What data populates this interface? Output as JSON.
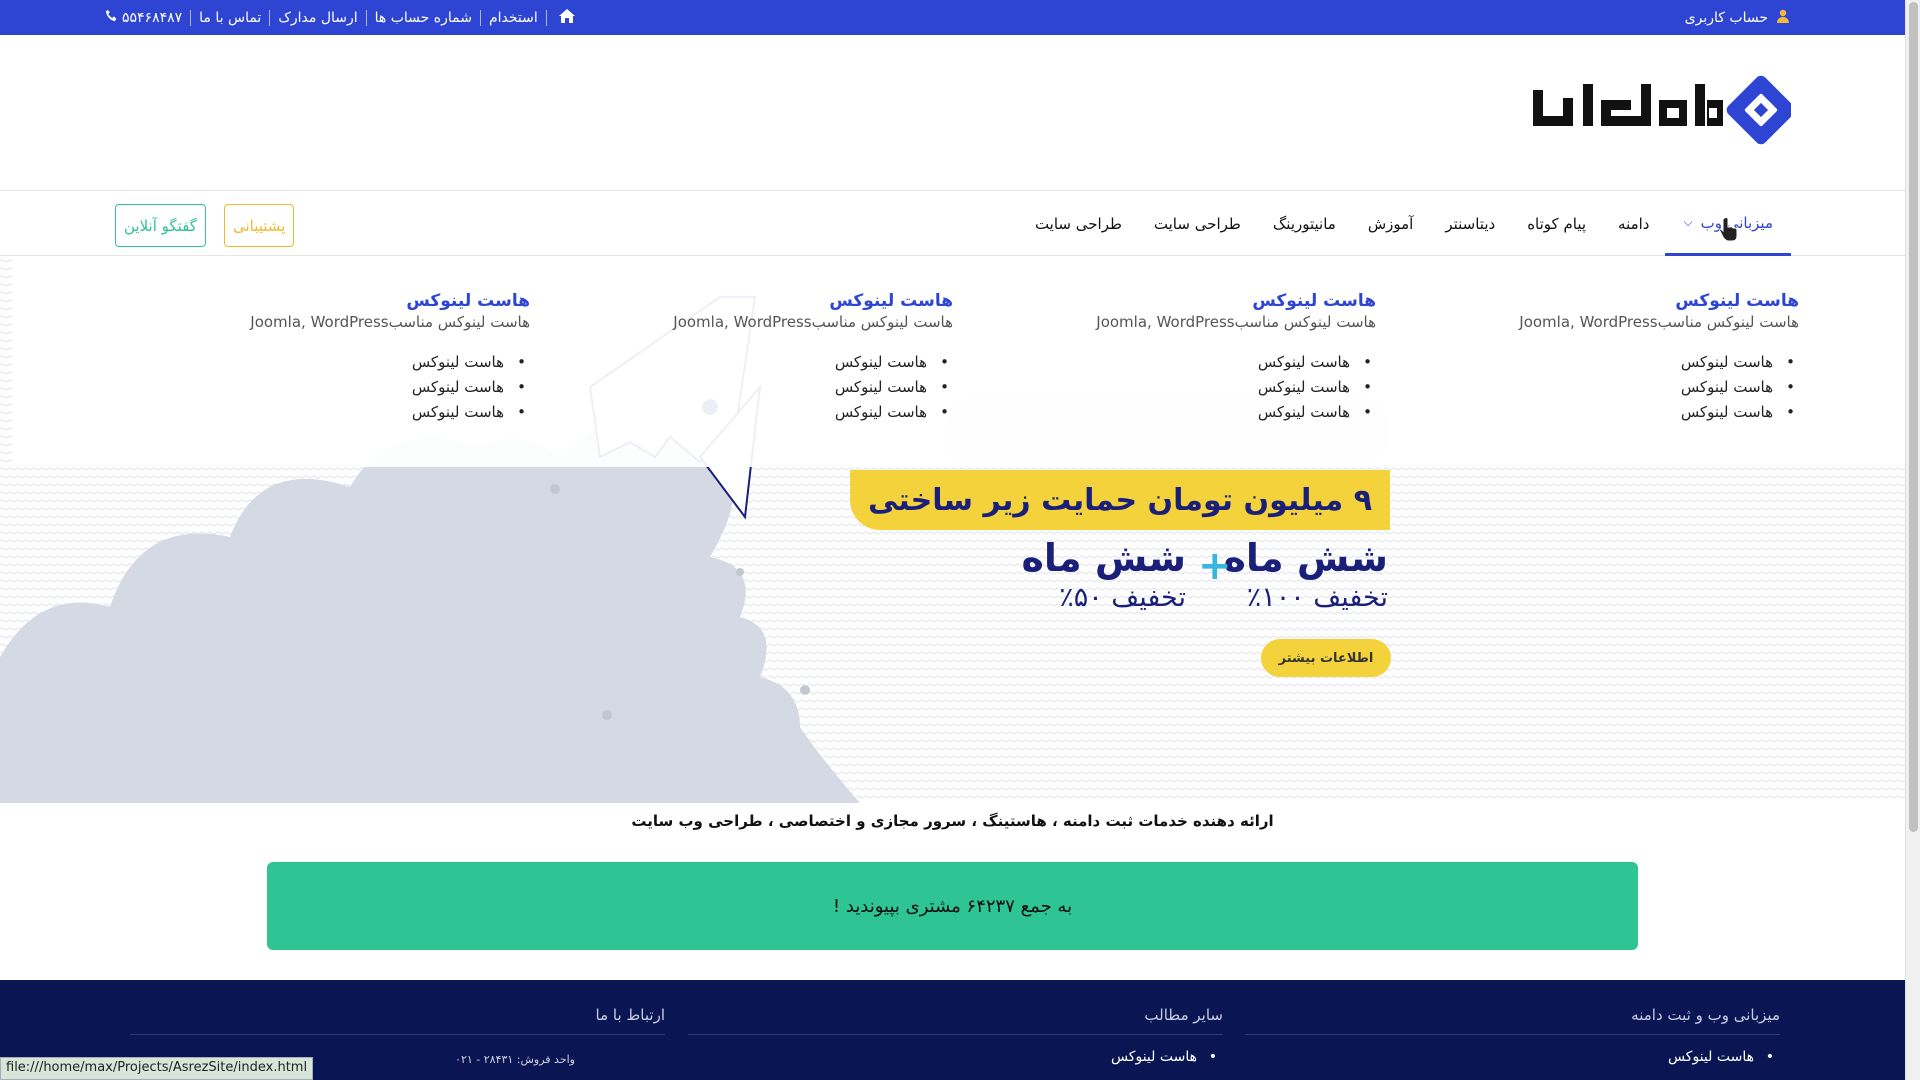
{
  "topbar": {
    "account": "حساب کاربری",
    "links": [
      "استخدام",
      "شماره حساب ها",
      "ارسال مدارک",
      "تماس با ما"
    ],
    "phone": "۵۵۴۶۸۴۸۷"
  },
  "logo": {
    "text": "هاست ایران"
  },
  "nav": {
    "items": [
      "میزبانی وب",
      "دامنه",
      "پیام کوتاه",
      "دیتاسنتر",
      "آموزش",
      "مانیتورینگ",
      "طراحی سایت",
      "طراحی سایت"
    ],
    "support": "پشتیبانی",
    "chat": "گفتگو آنلاین"
  },
  "mega": {
    "columns": [
      {
        "title": "هاست لینوکس",
        "desc": "هاست لینوکس مناسبJoomla, WordPress",
        "items": [
          "هاست لینوکس",
          "هاست لینوکس",
          "هاست لینوکس"
        ]
      },
      {
        "title": "هاست لینوکس",
        "desc": "هاست لینوکس مناسبJoomla, WordPress",
        "items": [
          "هاست لینوکس",
          "هاست لینوکس",
          "هاست لینوکس"
        ]
      },
      {
        "title": "هاست لینوکس",
        "desc": "هاست لینوکس مناسبJoomla, WordPress",
        "items": [
          "هاست لینوکس",
          "هاست لینوکس",
          "هاست لینوکس"
        ]
      },
      {
        "title": "هاست لینوکس",
        "desc": "هاست لینوکس مناسبJoomla, WordPress",
        "items": [
          "هاست لینوکس",
          "هاست لینوکس",
          "هاست لینوکس"
        ]
      }
    ]
  },
  "hero": {
    "yellow_headline": "۹ میلیون تومان حمایت زیر ساختی",
    "six_a": "شش ماه",
    "six_b": "شش ماه",
    "off_a": "تخفیف ۱۰۰٪",
    "off_b": "تخفیف ۵۰٪",
    "more_button": "اطلاعات بیشتر"
  },
  "tagline": "ارائه دهنده خدمات ثبت دامنه ، هاستینگ ، سرور مجازی و اختصاصی ، طراحی وب سایت",
  "join": "به جمع ۶۴۲۳۷ مشتری بپیوندید !",
  "footer": {
    "col1_title": "میزبانی وب و ثبت دامنه",
    "col1_items": [
      "هاست لینوکس"
    ],
    "col2_title": "سایر مطالب",
    "col2_items": [
      "هاست لینوکس"
    ],
    "col3_title": "ارتباط با ما",
    "col3_addr": "واحد فروش: ۲۸۴۳۱ - ۰۲۱"
  },
  "status_url": "file:///home/max/Projects/AsrezSite/index.html",
  "colors": {
    "primary": "#2e45d4",
    "green": "#2ec493",
    "yellow": "#f4d23b",
    "navy": "#0a1653"
  }
}
